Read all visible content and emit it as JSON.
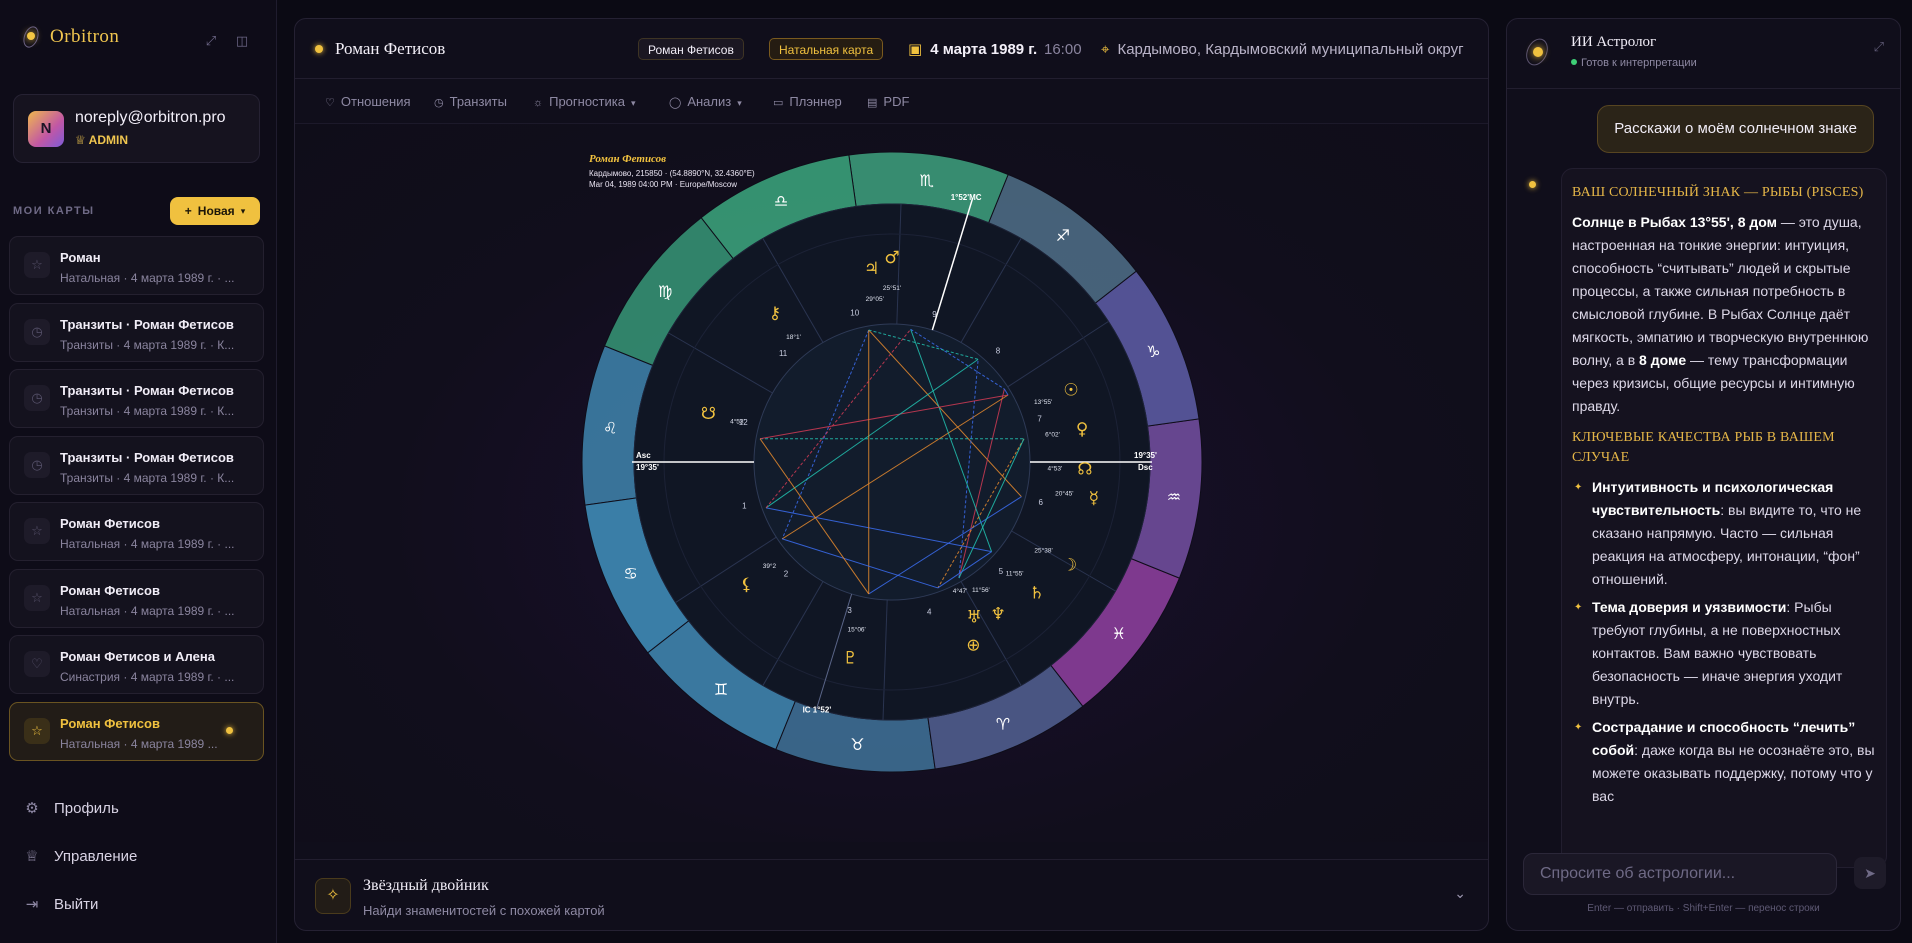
{
  "app": {
    "name": "Orbitron"
  },
  "user": {
    "initial": "N",
    "email": "noreply@orbitron.pro",
    "role": "ADMIN"
  },
  "sidebar": {
    "section_label": "МОИ КАРТЫ",
    "new_button": "Новая",
    "items": [
      {
        "title": "Роман",
        "subtitle": "Натальная · 4 марта 1989 г. · ...",
        "icon": "star-icon",
        "active": false
      },
      {
        "title": "Транзиты · Роман Фетисов",
        "subtitle": "Транзиты · 4 марта 1989 г. · К...",
        "icon": "clock-icon",
        "active": false
      },
      {
        "title": "Транзиты · Роман Фетисов",
        "subtitle": "Транзиты · 4 марта 1989 г. · К...",
        "icon": "clock-icon",
        "active": false
      },
      {
        "title": "Транзиты · Роман Фетисов",
        "subtitle": "Транзиты · 4 марта 1989 г. · К...",
        "icon": "clock-icon",
        "active": false
      },
      {
        "title": "Роман Фетисов",
        "subtitle": "Натальная · 4 марта 1989 г. · ...",
        "icon": "star-icon",
        "active": false
      },
      {
        "title": "Роман Фетисов",
        "subtitle": "Натальная · 4 марта 1989 г. · ...",
        "icon": "star-icon",
        "active": false
      },
      {
        "title": "Роман Фетисов и Алена",
        "subtitle": "Синастрия · 4 марта 1989 г. · ...",
        "icon": "heart-icon",
        "active": false
      },
      {
        "title": "Роман Фетисов",
        "subtitle": "Натальная · 4 марта 1989 ...",
        "icon": "star-icon",
        "active": true
      }
    ],
    "links": [
      {
        "label": "Профиль",
        "icon": "gear-icon"
      },
      {
        "label": "Управление",
        "icon": "crown-icon"
      },
      {
        "label": "Выйти",
        "icon": "logout-icon"
      }
    ]
  },
  "header": {
    "name": "Роман Фетисов",
    "pill_name": "Роман Фетисов",
    "pill_type": "Натальная карта",
    "date": "4 марта 1989 г.",
    "time": "16:00",
    "location": "Кардымово, Кардымовский муниципальный округ"
  },
  "tabs": [
    {
      "label": "Отношения",
      "icon": "heart-icon",
      "dropdown": false
    },
    {
      "label": "Транзиты",
      "icon": "clock-icon",
      "dropdown": false
    },
    {
      "label": "Прогностика",
      "icon": "sun-icon",
      "dropdown": true
    },
    {
      "label": "Анализ",
      "icon": "shield-icon",
      "dropdown": true
    },
    {
      "label": "Плэннер",
      "icon": "book-icon",
      "dropdown": false
    },
    {
      "label": "PDF",
      "icon": "file-icon",
      "dropdown": false
    }
  ],
  "chart": {
    "caption_name": "Роман Фетисов",
    "caption_place": "Кардымово, 215850 · (54.8890°N, 32.4360°E)",
    "caption_date": "Mar 04, 1989 04:00 PM · Europe/Moscow",
    "asc_label": "Asc",
    "asc_degree": "19°35'",
    "dsc_label": "Dsc",
    "dsc_degree": "19°35'",
    "mc_label": "1°52'MC",
    "ic_label": "IC 1°52'",
    "signs": [
      {
        "glyph": "♌",
        "color": "#3d7ea6"
      },
      {
        "glyph": "♋",
        "color": "#3f8bb6"
      },
      {
        "glyph": "♊",
        "color": "#3f84ad"
      },
      {
        "glyph": "♉",
        "color": "#3e6e93"
      },
      {
        "glyph": "♈",
        "color": "#4f5d8d"
      },
      {
        "glyph": "♓",
        "color": "#8a3e9a"
      },
      {
        "glyph": "♒",
        "color": "#6f4c9b"
      },
      {
        "glyph": "♑",
        "color": "#5a5aa1"
      },
      {
        "glyph": "♐",
        "color": "#4c6b83"
      },
      {
        "glyph": "♏",
        "color": "#3c9a7a"
      },
      {
        "glyph": "♎",
        "color": "#3aa07a"
      },
      {
        "glyph": "♍",
        "color": "#359073"
      }
    ],
    "houses": [
      "1",
      "2",
      "3",
      "4",
      "5",
      "6",
      "7",
      "8",
      "9",
      "10",
      "11",
      "12"
    ],
    "planets": [
      {
        "glyph": "☉",
        "label": "13°55'",
        "name": "sun"
      },
      {
        "glyph": "♀",
        "label": "6°02'",
        "name": "venus"
      },
      {
        "glyph": "☊",
        "label": "4°53'",
        "name": "north-node"
      },
      {
        "glyph": "☿",
        "label": "20°45'",
        "name": "mercury"
      },
      {
        "glyph": "☽",
        "label": "25°38'",
        "name": "moon"
      },
      {
        "glyph": "♄",
        "label": "11°55'",
        "name": "saturn"
      },
      {
        "glyph": "♆",
        "label": "11°56'",
        "name": "neptune"
      },
      {
        "glyph": "♅",
        "label": "4°47'",
        "name": "uranus"
      },
      {
        "glyph": "⊕",
        "label": "",
        "name": "part-of-fortune"
      },
      {
        "glyph": "♇",
        "label": "15°06'",
        "name": "pluto"
      },
      {
        "glyph": "⚸",
        "label": "39°2",
        "name": "lilith"
      },
      {
        "glyph": "☋",
        "label": "4°53'",
        "name": "south-node"
      },
      {
        "glyph": "⚷",
        "label": "18°1'",
        "name": "chiron"
      },
      {
        "glyph": "♃",
        "label": "29°05'",
        "name": "jupiter"
      },
      {
        "glyph": "♂",
        "label": "25°51'",
        "name": "mars"
      }
    ]
  },
  "star_twin": {
    "title": "Звёздный двойник",
    "subtitle": "Найди знаменитостей с похожей картой"
  },
  "ai": {
    "title": "ИИ Астролог",
    "status": "Готов к интерпретации",
    "user_message": "Расскажи о моём солнечном знаке",
    "heading1": "Ваш солнечный знак — Рыбы (Pisces)",
    "p1_bold": "Солнце в Рыбах 13°55', 8 дом",
    "p1_text": " — это душа, настроенная на тонкие энергии: интуиция, способность “считывать” людей и скрытые процессы, а также сильная потребность в смысловой глубине. В Рыбах Солнце даёт мягкость, эмпатию и творческую внутреннюю волну, а в ",
    "p1_bold2": "8 доме",
    "p1_text2": " — тему трансформации через кризисы, общие ресурсы и интимную правду.",
    "heading2": "Ключевые качества Рыб в вашем случае",
    "points": [
      {
        "bold": "Интуитивность и психологическая чувствительность",
        "text": ": вы видите то, что не сказано напрямую. Часто — сильная реакция на атмосферу, интонации, “фон” отношений."
      },
      {
        "bold": "Тема доверия и уязвимости",
        "text": ": Рыбы требуют глубины, а не поверхностных контактов. Вам важно чувствовать безопасность — иначе энергия уходит внутрь."
      },
      {
        "bold": "Сострадание и способность “лечить” собой",
        "text": ": даже когда вы не осознаёте это, вы можете оказывать поддержку, потому что у вас"
      }
    ],
    "input_placeholder": "Спросите об астрологии...",
    "hint": "Enter — отправить · Shift+Enter — перенос строки"
  }
}
